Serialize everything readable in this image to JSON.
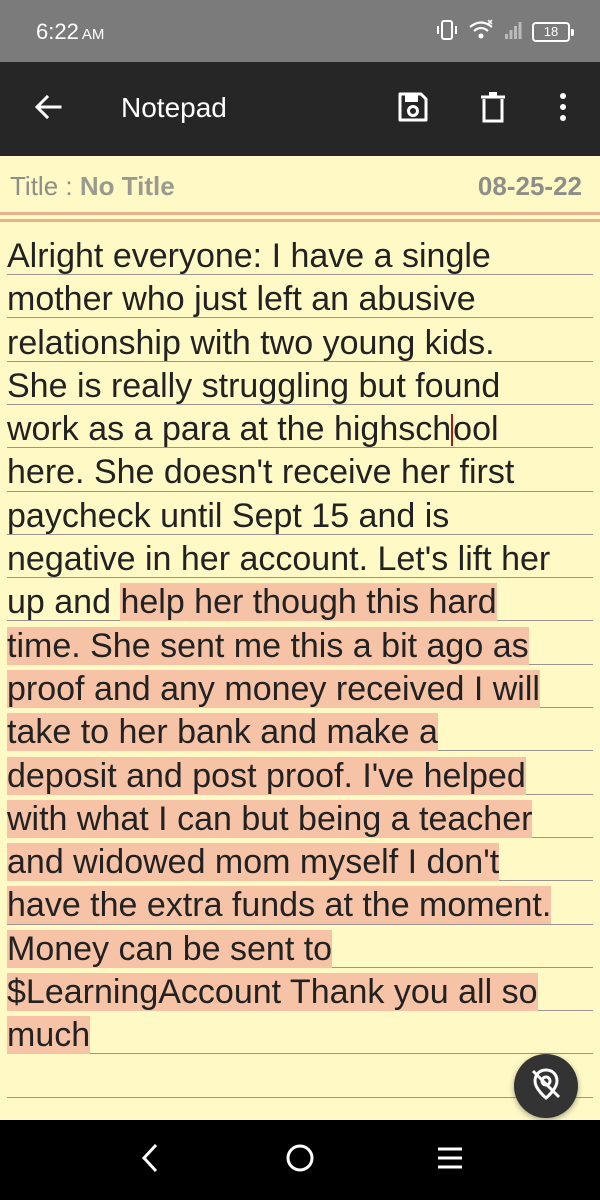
{
  "status_bar": {
    "time": "6:22",
    "ampm": "AM",
    "battery": "18",
    "icons": [
      "vibrate-icon",
      "wifi-icon",
      "signal-icon",
      "battery-icon"
    ]
  },
  "app_bar": {
    "title": "Notepad",
    "icons": [
      "back-arrow-icon",
      "save-icon",
      "delete-icon",
      "more-vert-icon"
    ]
  },
  "note": {
    "title_label": "Title :",
    "title_value": "No Title",
    "date": "08-25-22",
    "lines": [
      {
        "pre": "Alright everyone: I have a single",
        "hl": ""
      },
      {
        "pre": "mother who just left an abusive",
        "hl": ""
      },
      {
        "pre": "relationship with two young kids.",
        "hl": ""
      },
      {
        "pre": "She is really struggling but found",
        "hl": ""
      },
      {
        "pre": "work as a para at the highsch",
        "caret": true,
        "post": "ool"
      },
      {
        "pre": "here. She doesn't receive her first",
        "hl": ""
      },
      {
        "pre": "paycheck until Sept 15 and is",
        "hl": ""
      },
      {
        "pre": "negative in her account. Let's lift her",
        "hl": ""
      },
      {
        "pre": "up and ",
        "hl": "help her though this hard"
      },
      {
        "pre": "",
        "hl": "time. She sent me this a bit ago as"
      },
      {
        "pre": "",
        "hl": "proof and any money received I will"
      },
      {
        "pre": "",
        "hl": "take to her bank and make a"
      },
      {
        "pre": "",
        "hl": "deposit and post proof. I've helped"
      },
      {
        "pre": "",
        "hl": "with what I can but being a teacher"
      },
      {
        "pre": "",
        "hl": "and widowed mom myself I don't"
      },
      {
        "pre": "",
        "hl": "have the extra funds at the moment."
      },
      {
        "pre": "",
        "hl": "Money can be sent to"
      },
      {
        "pre": "",
        "hl": "$LearningAccount Thank you all so"
      },
      {
        "pre": "",
        "hl": "much "
      }
    ]
  },
  "fab": {
    "icon": "pin-off-icon"
  },
  "nav_bar": {
    "icons": [
      "nav-back-icon",
      "nav-home-icon",
      "nav-recents-icon"
    ]
  },
  "colors": {
    "paper": "#FFF9C6",
    "app_bar": "#262626",
    "status_bar": "#7B7B7B",
    "highlight": "#F6C3A7",
    "title_rule": "#E8B08E",
    "caret": "#B01818"
  }
}
